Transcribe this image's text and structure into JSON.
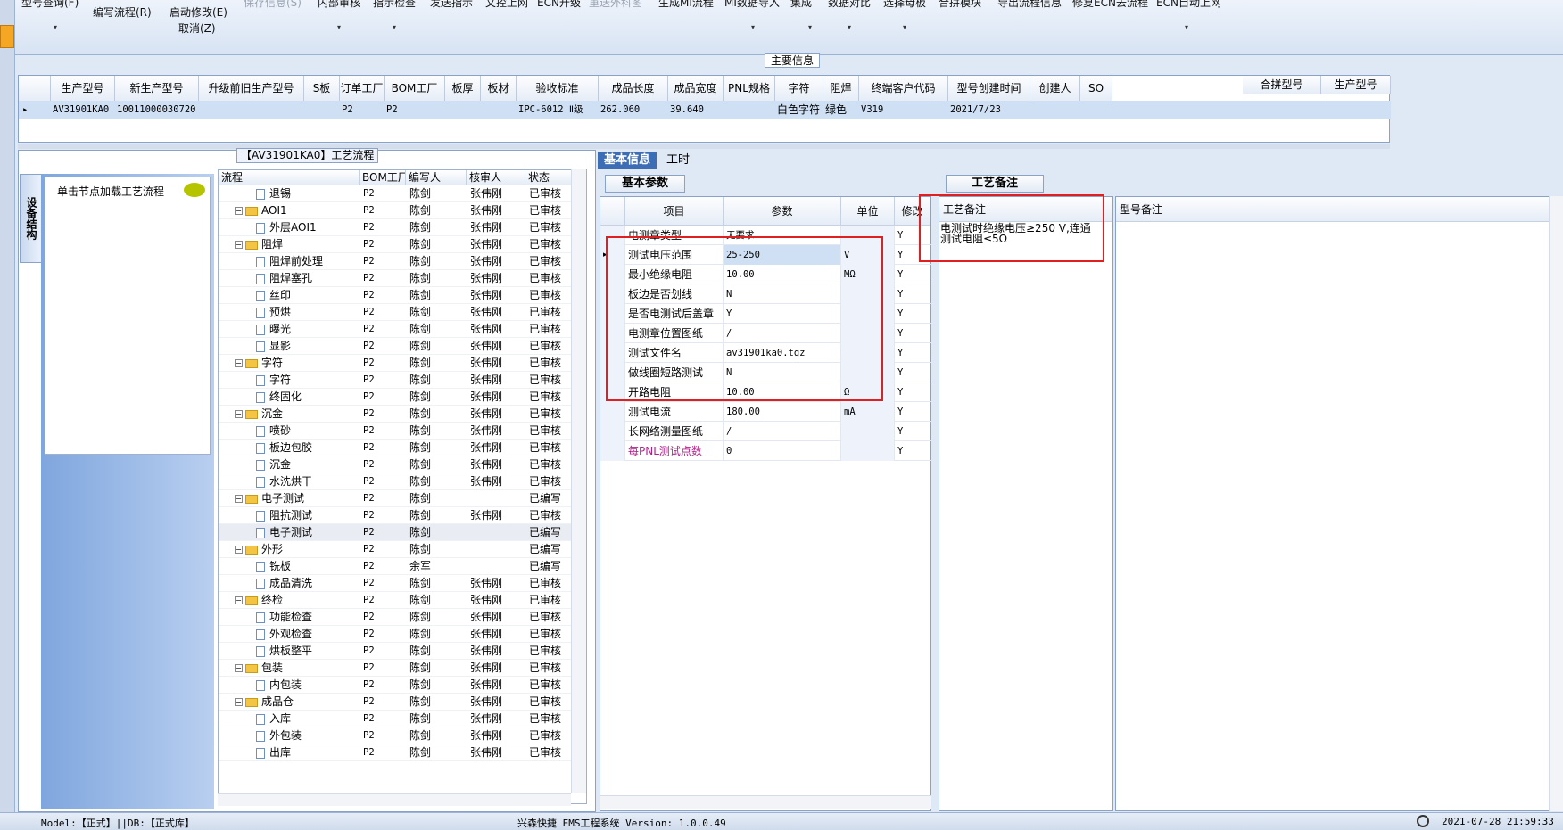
{
  "toolbar": {
    "items": [
      {
        "label": "型号查询(F)",
        "disabled": false
      },
      {
        "label": "编写流程(R)",
        "disabled": false
      },
      {
        "label": "启动修改(E)",
        "disabled": false
      },
      {
        "label": "取消(Z)",
        "disabled": false
      },
      {
        "label": "保存信息(S)",
        "disabled": true
      },
      {
        "label": "内部审核",
        "disabled": false
      },
      {
        "label": "指示检查",
        "disabled": false
      },
      {
        "label": "发送指示",
        "disabled": false
      },
      {
        "label": "文控上网",
        "disabled": false
      },
      {
        "label": "ECN升级",
        "disabled": false
      },
      {
        "label": "重送外科图",
        "disabled": true
      },
      {
        "label": "生成MI流程",
        "disabled": false
      },
      {
        "label": "MI数据导入",
        "disabled": false
      },
      {
        "label": "集成",
        "disabled": false
      },
      {
        "label": "数据对比",
        "disabled": false
      },
      {
        "label": "选择母板",
        "disabled": false
      },
      {
        "label": "合拼模块",
        "disabled": false
      },
      {
        "label": "导出流程信息",
        "disabled": false
      },
      {
        "label": "修复ECN去流程",
        "disabled": false
      },
      {
        "label": "ECN自动上网",
        "disabled": false
      }
    ]
  },
  "main_info": {
    "title": "主要信息",
    "columns": [
      "生产型号",
      "新生产型号",
      "升级前旧生产型号",
      "S板",
      "订单工厂",
      "BOM工厂",
      "板厚",
      "板材",
      "验收标准",
      "成品长度",
      "成品宽度",
      "PNL规格",
      "字符",
      "阻焊",
      "终端客户代码",
      "型号创建时间",
      "创建人",
      "SO"
    ],
    "row": {
      "生产型号": "AV31901KA0",
      "新生产型号": "10011000030720",
      "升级前旧生产型号": "",
      "S板": "",
      "订单工厂": "P2",
      "BOM工厂": "P2",
      "板厚": "",
      "板材": "",
      "验收标准": "IPC-6012 Ⅱ级",
      "成品长度": "262.060",
      "成品宽度": "39.640",
      "PNL规格": "",
      "字符": "白色字符",
      "阻焊": "绿色",
      "终端客户代码": "V319",
      "型号创建时间": "2021/7/23",
      "创建人": "",
      "SO": ""
    },
    "side_columns": [
      "合拼型号",
      "生产型号"
    ]
  },
  "flow": {
    "title": "【AV31901KA0】工艺流程",
    "side_tab": "设备结构",
    "hint": "单击节点加载工艺流程",
    "columns": [
      "流程",
      "BOM工厂",
      "编写人",
      "核审人",
      "状态"
    ],
    "rows": [
      {
        "name": "退锡",
        "level": 1,
        "factory": "P2",
        "writer": "陈剑",
        "reviewer": "张伟刚",
        "status": "已审核"
      },
      {
        "name": "AOI1",
        "level": 0,
        "factory": "P2",
        "writer": "陈剑",
        "reviewer": "张伟刚",
        "status": "已审核"
      },
      {
        "name": "外层AOI1",
        "level": 1,
        "factory": "P2",
        "writer": "陈剑",
        "reviewer": "张伟刚",
        "status": "已审核"
      },
      {
        "name": "阻焊",
        "level": 0,
        "factory": "P2",
        "writer": "陈剑",
        "reviewer": "张伟刚",
        "status": "已审核"
      },
      {
        "name": "阻焊前处理",
        "level": 1,
        "factory": "P2",
        "writer": "陈剑",
        "reviewer": "张伟刚",
        "status": "已审核"
      },
      {
        "name": "阻焊塞孔",
        "level": 1,
        "factory": "P2",
        "writer": "陈剑",
        "reviewer": "张伟刚",
        "status": "已审核"
      },
      {
        "name": "丝印",
        "level": 1,
        "factory": "P2",
        "writer": "陈剑",
        "reviewer": "张伟刚",
        "status": "已审核"
      },
      {
        "name": "预烘",
        "level": 1,
        "factory": "P2",
        "writer": "陈剑",
        "reviewer": "张伟刚",
        "status": "已审核"
      },
      {
        "name": "曝光",
        "level": 1,
        "factory": "P2",
        "writer": "陈剑",
        "reviewer": "张伟刚",
        "status": "已审核"
      },
      {
        "name": "显影",
        "level": 1,
        "factory": "P2",
        "writer": "陈剑",
        "reviewer": "张伟刚",
        "status": "已审核"
      },
      {
        "name": "字符",
        "level": 0,
        "factory": "P2",
        "writer": "陈剑",
        "reviewer": "张伟刚",
        "status": "已审核"
      },
      {
        "name": "字符",
        "level": 1,
        "factory": "P2",
        "writer": "陈剑",
        "reviewer": "张伟刚",
        "status": "已审核"
      },
      {
        "name": "终固化",
        "level": 1,
        "factory": "P2",
        "writer": "陈剑",
        "reviewer": "张伟刚",
        "status": "已审核"
      },
      {
        "name": "沉金",
        "level": 0,
        "factory": "P2",
        "writer": "陈剑",
        "reviewer": "张伟刚",
        "status": "已审核"
      },
      {
        "name": "喷砂",
        "level": 1,
        "factory": "P2",
        "writer": "陈剑",
        "reviewer": "张伟刚",
        "status": "已审核"
      },
      {
        "name": "板边包胶",
        "level": 1,
        "factory": "P2",
        "writer": "陈剑",
        "reviewer": "张伟刚",
        "status": "已审核"
      },
      {
        "name": "沉金",
        "level": 1,
        "factory": "P2",
        "writer": "陈剑",
        "reviewer": "张伟刚",
        "status": "已审核"
      },
      {
        "name": "水洗烘干",
        "level": 1,
        "factory": "P2",
        "writer": "陈剑",
        "reviewer": "张伟刚",
        "status": "已审核"
      },
      {
        "name": "电子测试",
        "level": 0,
        "factory": "P2",
        "writer": "陈剑",
        "reviewer": "",
        "status": "已编写"
      },
      {
        "name": "阻抗测试",
        "level": 1,
        "factory": "P2",
        "writer": "陈剑",
        "reviewer": "张伟刚",
        "status": "已审核"
      },
      {
        "name": "电子测试",
        "level": 1,
        "factory": "P2",
        "writer": "陈剑",
        "reviewer": "",
        "status": "已编写",
        "selected": true
      },
      {
        "name": "外形",
        "level": 0,
        "factory": "P2",
        "writer": "陈剑",
        "reviewer": "",
        "status": "已编写"
      },
      {
        "name": "铣板",
        "level": 1,
        "factory": "P2",
        "writer": "余军",
        "reviewer": "",
        "status": "已编写"
      },
      {
        "name": "成品清洗",
        "level": 1,
        "factory": "P2",
        "writer": "陈剑",
        "reviewer": "张伟刚",
        "status": "已审核"
      },
      {
        "name": "终检",
        "level": 0,
        "factory": "P2",
        "writer": "陈剑",
        "reviewer": "张伟刚",
        "status": "已审核"
      },
      {
        "name": "功能检查",
        "level": 1,
        "factory": "P2",
        "writer": "陈剑",
        "reviewer": "张伟刚",
        "status": "已审核"
      },
      {
        "name": "外观检查",
        "level": 1,
        "factory": "P2",
        "writer": "陈剑",
        "reviewer": "张伟刚",
        "status": "已审核"
      },
      {
        "name": "烘板整平",
        "level": 1,
        "factory": "P2",
        "writer": "陈剑",
        "reviewer": "张伟刚",
        "status": "已审核"
      },
      {
        "name": "包装",
        "level": 0,
        "factory": "P2",
        "writer": "陈剑",
        "reviewer": "张伟刚",
        "status": "已审核"
      },
      {
        "name": "内包装",
        "level": 1,
        "factory": "P2",
        "writer": "陈剑",
        "reviewer": "张伟刚",
        "status": "已审核"
      },
      {
        "name": "成品仓",
        "level": 0,
        "factory": "P2",
        "writer": "陈剑",
        "reviewer": "张伟刚",
        "status": "已审核"
      },
      {
        "name": "入库",
        "level": 1,
        "factory": "P2",
        "writer": "陈剑",
        "reviewer": "张伟刚",
        "status": "已审核"
      },
      {
        "name": "外包装",
        "level": 1,
        "factory": "P2",
        "writer": "陈剑",
        "reviewer": "张伟刚",
        "status": "已审核"
      },
      {
        "name": "出库",
        "level": 1,
        "factory": "P2",
        "writer": "陈剑",
        "reviewer": "张伟刚",
        "status": "已审核"
      }
    ]
  },
  "params": {
    "tabs": [
      "基本信息",
      "工时"
    ],
    "subtab": "基本参数",
    "columns": [
      "项目",
      "参数",
      "单位",
      "修改"
    ],
    "rows": [
      {
        "item": "电测章类型",
        "value": "无要求",
        "unit": "",
        "mod": "Y"
      },
      {
        "item": "测试电压范围",
        "value": "25-250",
        "unit": "V",
        "mod": "Y",
        "selected": true
      },
      {
        "item": "最小绝缘电阻",
        "value": "10.00",
        "unit": "MΩ",
        "mod": "Y"
      },
      {
        "item": "板边是否划线",
        "value": "N",
        "unit": "",
        "mod": "Y"
      },
      {
        "item": "是否电测试后盖章",
        "value": "Y",
        "unit": "",
        "mod": "Y"
      },
      {
        "item": "电测章位置图纸",
        "value": "/",
        "unit": "",
        "mod": "Y"
      },
      {
        "item": "测试文件名",
        "value": "av31901ka0.tgz",
        "unit": "",
        "mod": "Y"
      },
      {
        "item": "做线圈短路测试",
        "value": "N",
        "unit": "",
        "mod": "Y"
      },
      {
        "item": "开路电阻",
        "value": "10.00",
        "unit": "Ω",
        "mod": "Y"
      },
      {
        "item": "测试电流",
        "value": "180.00",
        "unit": "mA",
        "mod": "Y"
      },
      {
        "item": "长网络测量图纸",
        "value": "/",
        "unit": "",
        "mod": "Y"
      },
      {
        "item": "每PNL测试点数",
        "value": "0",
        "unit": "",
        "mod": "Y",
        "color": "#b0208a"
      }
    ]
  },
  "notes": {
    "tab": "工艺备注",
    "col1": "工艺备注",
    "col2": "型号备注",
    "line1": "电测试时绝缘电压≥250 V,连通",
    "line2": "测试电阻≤5Ω"
  },
  "status": {
    "model": "Model:【正式】||DB:【正式库】",
    "app": "兴森快捷 EMS工程系统 Version: 1.0.0.49",
    "time": "2021-07-28 21:59:33"
  },
  "colors": {
    "accent": "#3d6db5",
    "highlight": "#e02020",
    "selected": "#cfe0f5"
  }
}
